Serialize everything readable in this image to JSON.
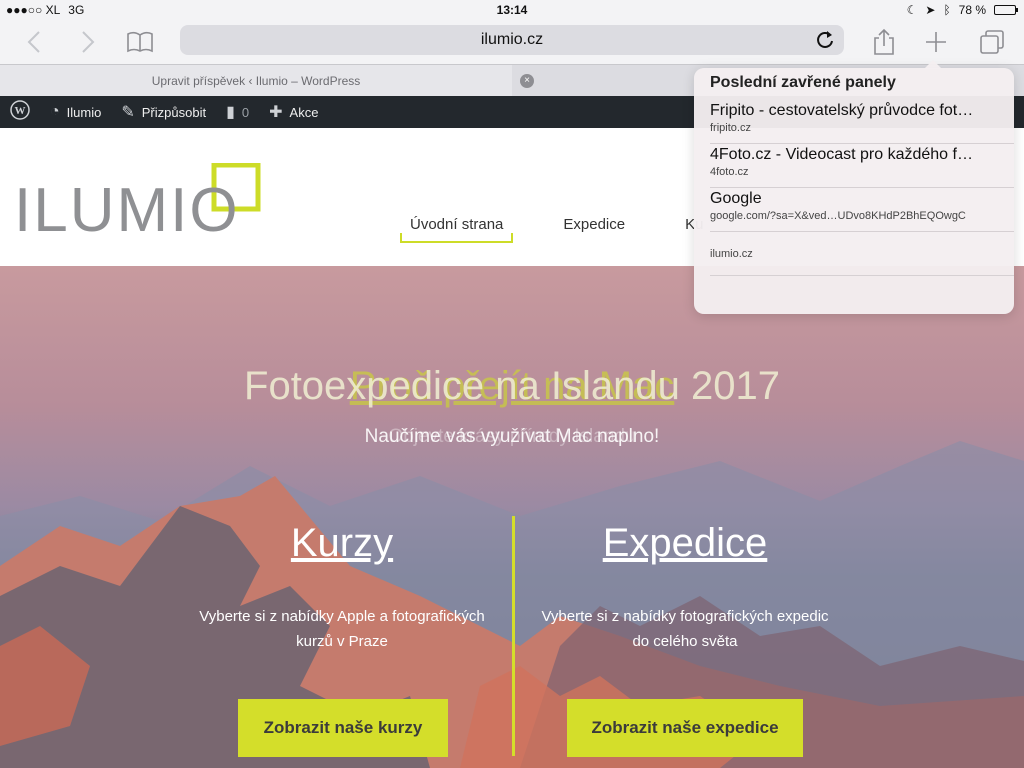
{
  "status": {
    "carrier": "●●●○○ XL",
    "network": "3G",
    "time": "13:14",
    "battery_percent": "78 %",
    "battery_level": 0.78
  },
  "toolbar": {
    "address": "ilumio.cz",
    "icons": [
      "back-icon",
      "forward-icon",
      "bookmarks-icon",
      "reload-icon",
      "share-icon",
      "new-tab-icon",
      "tabs-icon"
    ]
  },
  "tabs": {
    "active_title": "Upravit příspěvek ‹ Ilumio – WordPress",
    "close_glyph": "×"
  },
  "adminbar": {
    "site": "Ilumio",
    "customize": "Přizpůsobit",
    "comments_count": "0",
    "new": "Akce"
  },
  "site": {
    "logo_text": "ILUMIO",
    "nav": [
      "Úvodní strana",
      "Expedice",
      "Ku"
    ]
  },
  "hero": {
    "title_a": "Fotoexpedice na Islandu 2017",
    "title_b": "Proč přejít na Mac",
    "sub_a": "Objevte krásy přírody Islandu",
    "sub_b": "Naučíme vás využívat Mac naplno!",
    "col_left": {
      "heading": "Kurzy",
      "text_line1": "Vyberte si z nabídky Apple a fotografických",
      "text_line2": "kurzů v Praze",
      "button": "Zobrazit naše kurzy"
    },
    "col_right": {
      "heading": "Expedice",
      "text_line1": "Vyberte si z nabídky fotografických expedic",
      "text_line2": "do celého světa",
      "button": "Zobrazit naše expedice"
    }
  },
  "recently_closed": {
    "title": "Poslední zavřené panely",
    "items": [
      {
        "title": "Fripito - cestovatelský průvodce fot…",
        "url": "fripito.cz"
      },
      {
        "title": "4Foto.cz - Videocast pro každého f…",
        "url": "4foto.cz"
      },
      {
        "title": "Google",
        "url": "google.com/?sa=X&ved…UDvo8KHdP2BhEQOwgC"
      },
      {
        "title": "",
        "url": "ilumio.cz"
      }
    ]
  },
  "colors": {
    "accent": "#d4de2a",
    "adminbar": "#23282d"
  }
}
